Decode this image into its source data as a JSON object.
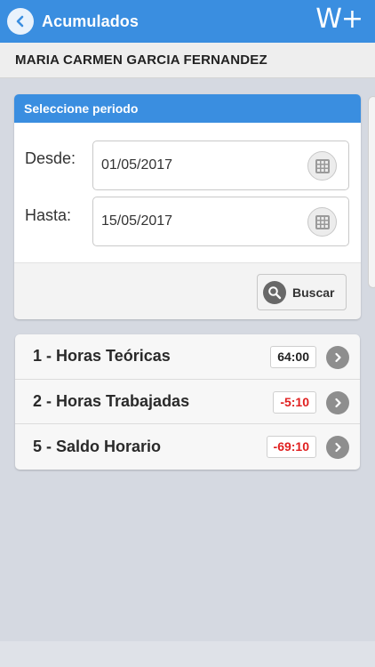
{
  "header": {
    "title": "Acumulados",
    "brand": "W+",
    "back_icon": "chevron-left-icon",
    "accent": "#3a8ee0"
  },
  "user": {
    "name": "MARIA CARMEN GARCIA FERNANDEZ"
  },
  "period": {
    "title": "Seleccione periodo",
    "from_label": "Desde:",
    "from_value": "01/05/2017",
    "to_label": "Hasta:",
    "to_value": "15/05/2017",
    "calendar_icon": "calendar-grid-icon",
    "search_label": "Buscar",
    "search_icon": "magnifier-icon"
  },
  "items": [
    {
      "label": "1 - Horas Teóricas",
      "value": "64:00",
      "value_color": "#222222"
    },
    {
      "label": "2 - Horas Trabajadas",
      "value": "-5:10",
      "value_color": "#e02020"
    },
    {
      "label": "5 - Saldo Horario",
      "value": "-69:10",
      "value_color": "#e02020"
    }
  ]
}
